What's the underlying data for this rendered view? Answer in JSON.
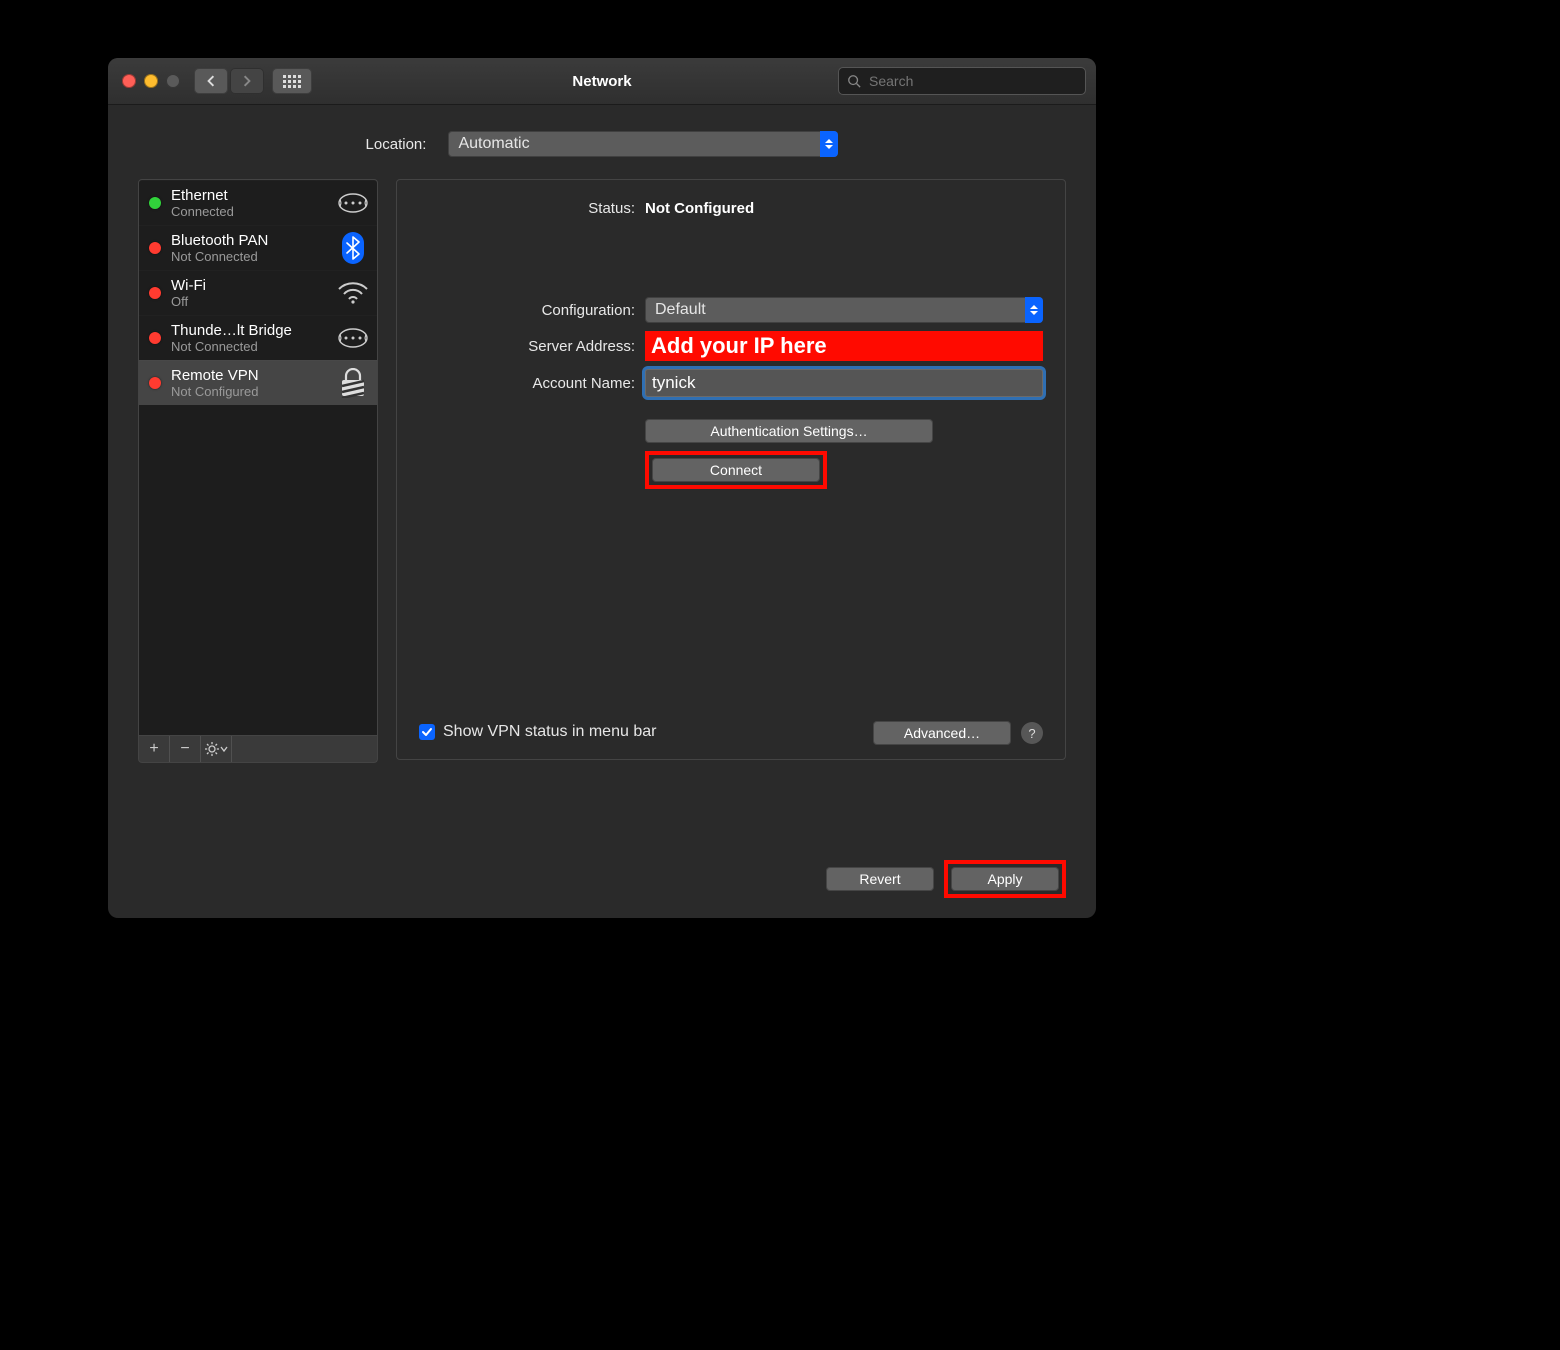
{
  "window": {
    "title": "Network"
  },
  "search": {
    "placeholder": "Search"
  },
  "location": {
    "label": "Location:",
    "value": "Automatic"
  },
  "services": [
    {
      "name": "Ethernet",
      "status": "Connected",
      "state": "green",
      "icon": "ethernet",
      "selected": false
    },
    {
      "name": "Bluetooth PAN",
      "status": "Not Connected",
      "state": "red",
      "icon": "bluetooth",
      "selected": false
    },
    {
      "name": "Wi-Fi",
      "status": "Off",
      "state": "red",
      "icon": "wifi",
      "selected": false
    },
    {
      "name": "Thunde…lt Bridge",
      "status": "Not Connected",
      "state": "red",
      "icon": "ethernet",
      "selected": false
    },
    {
      "name": "Remote VPN",
      "status": "Not Configured",
      "state": "red",
      "icon": "vpn",
      "selected": true
    }
  ],
  "detail": {
    "status_label": "Status:",
    "status_value": "Not Configured",
    "config_label": "Configuration:",
    "config_value": "Default",
    "server_label": "Server Address:",
    "server_overlay": "Add your IP here",
    "account_label": "Account Name:",
    "account_value": "tynick",
    "auth_button": "Authentication Settings…",
    "connect_button": "Connect",
    "show_status_label": "Show VPN status in menu bar",
    "show_status_checked": true,
    "advanced_button": "Advanced…"
  },
  "footer": {
    "revert": "Revert",
    "apply": "Apply"
  }
}
